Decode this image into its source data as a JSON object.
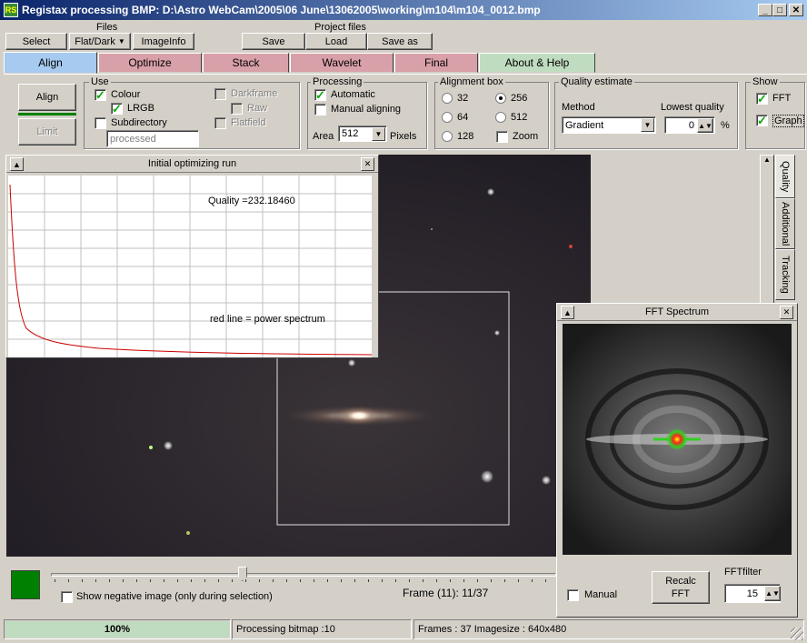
{
  "window": {
    "title": "Registax processing BMP: D:\\Astro WebCam\\2005\\06 June\\13062005\\working\\m104\\m104_0012.bmp",
    "app_icon": "RS"
  },
  "files": {
    "heading": "Files",
    "select": "Select",
    "flatdark": "Flat/Dark",
    "imageinfo": "ImageInfo"
  },
  "project": {
    "heading": "Project files",
    "save": "Save",
    "load": "Load",
    "saveas": "Save as"
  },
  "tabs": [
    {
      "label": "Align",
      "color": "#a6caf0"
    },
    {
      "label": "Optimize",
      "color": "#d8a0a8"
    },
    {
      "label": "Stack",
      "color": "#d8a0a8"
    },
    {
      "label": "Wavelet",
      "color": "#d8a0a8"
    },
    {
      "label": "Final",
      "color": "#d8a0a8"
    },
    {
      "label": "About & Help",
      "color": "#c0dcc0"
    }
  ],
  "align_buttons": {
    "align": "Align",
    "limit": "Limit"
  },
  "use": {
    "title": "Use",
    "colour": "Colour",
    "lrgb": "LRGB",
    "subdirectory": "Subdirectory",
    "subdir_placeholder": "processed",
    "darkframe": "Darkframe",
    "raw": "Raw",
    "flatfield": "Flatfield"
  },
  "processing": {
    "title": "Processing",
    "automatic": "Automatic",
    "manual": "Manual aligning",
    "area_label": "Area",
    "area_value": "512",
    "pixels": "Pixels"
  },
  "alignbox": {
    "title": "Alignment box",
    "o32": "32",
    "o64": "64",
    "o128": "128",
    "o256": "256",
    "o512": "512",
    "zoom": "Zoom",
    "selected": "256"
  },
  "quality": {
    "title": "Quality estimate",
    "method_label": "Method",
    "method_value": "Gradient",
    "lowest_label": "Lowest quality",
    "lowest_value": "0",
    "percent": "%"
  },
  "show": {
    "title": "Show",
    "fft": "FFT",
    "graph": "Graph"
  },
  "side_tabs": {
    "quality": "Quality",
    "additional": "Additional",
    "tracking": "Tracking"
  },
  "graph_panel": {
    "title": "Initial optimizing run",
    "quality_text": "Quality =232.18460",
    "legend_text": "red line = power spectrum"
  },
  "fft_panel": {
    "title": "FFT Spectrum",
    "manual": "Manual",
    "recalc": "Recalc\nFFT",
    "filter_label": "FFTfilter",
    "filter_value": "15"
  },
  "bottom": {
    "negative": "Show negative image (only during selection)",
    "frame": "Frame (11): 11/37",
    "slider_fraction": 0.37
  },
  "status": {
    "progress": "100%",
    "processing": "Processing bitmap :10",
    "frames": "Frames : 37 Imagesize : 640x480"
  },
  "colors": {
    "progress": "#c0dcc0",
    "indicator": "#008000",
    "curve": "#cc0000"
  }
}
